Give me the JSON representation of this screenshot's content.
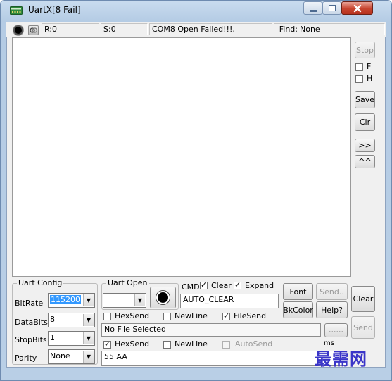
{
  "window": {
    "title": "UartX[8 Fail]",
    "accent": "#3a35c8"
  },
  "status": {
    "r_label": "R:0",
    "s_label": "S:0",
    "message": "COM8 Open Failed!!!,",
    "find_label": "Find:",
    "find_value": "None"
  },
  "side": {
    "stop": "Stop",
    "f_label": "F",
    "h_label": "H",
    "save": "Save",
    "clr": "Clr",
    "expand": ">>",
    "collapse": "^^"
  },
  "uart_config": {
    "title": "Uart Config",
    "bitrate_label": "BitRate",
    "bitrate_value": "115200",
    "databits_label": "DataBits",
    "databits_value": "8",
    "stopbits_label": "StopBits",
    "stopbits_value": "1",
    "parity_label": "Parity",
    "parity_value": "None"
  },
  "uart_open": {
    "title": "Uart Open",
    "port_value": ""
  },
  "cmd": {
    "cmd_label": "CMD",
    "clear_label": "Clear",
    "expand_label": "Expand",
    "auto_clear": "AUTO_CLEAR"
  },
  "buttons": {
    "font": "Font",
    "send_dots": "Send..",
    "bkcolor": "BkColor",
    "help": "Help?",
    "clear": "Clear",
    "send": "Send",
    "browse": "......"
  },
  "options_row1": {
    "hexsend": "HexSend",
    "newline": "NewLine",
    "filesend": "FileSend"
  },
  "file": {
    "path": "No File Selected"
  },
  "options_row2": {
    "hexsend": "HexSend",
    "newline": "NewLine",
    "autosend": "AutoSend",
    "ms_label": "ms"
  },
  "send_data": {
    "value": "55 AA"
  },
  "watermark": "最需网"
}
